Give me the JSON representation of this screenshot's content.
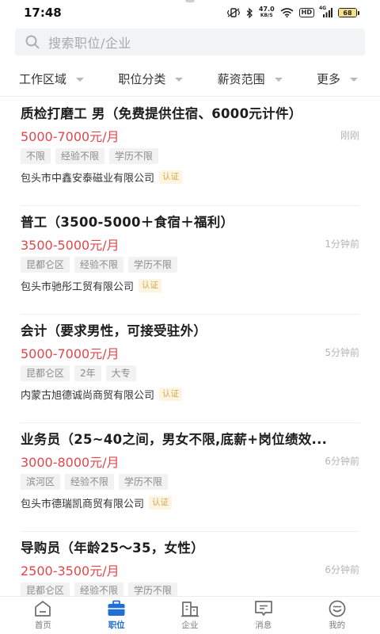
{
  "status_bar": {
    "time": "17:48",
    "net_speed_value": "47.0",
    "net_speed_unit": "KB/S",
    "hd_label": "HD",
    "signal_label": "4G",
    "battery": "68"
  },
  "search": {
    "placeholder": "搜索职位/企业"
  },
  "filters": [
    {
      "label": "工作区域"
    },
    {
      "label": "职位分类"
    },
    {
      "label": "薪资范围"
    },
    {
      "label": "更多"
    }
  ],
  "jobs": [
    {
      "title": "质检打磨工 男（免费提供住宿、6000元计件）",
      "salary": "5000-7000元/月",
      "time": "刚刚",
      "tags": [
        "不限",
        "经验不限",
        "学历不限"
      ],
      "company": "包头市中鑫安泰磁业有限公司",
      "badge": "认证"
    },
    {
      "title": "普工（3500-5000＋食宿＋福利）",
      "salary": "3500-5000元/月",
      "time": "1分钟前",
      "tags": [
        "昆都仑区",
        "经验不限",
        "学历不限"
      ],
      "company": "包头市驰彤工贸有限公司",
      "badge": "认证"
    },
    {
      "title": "会计（要求男性，可接受驻外）",
      "salary": "5000-7000元/月",
      "time": "5分钟前",
      "tags": [
        "昆都仑区",
        "2年",
        "大专"
      ],
      "company": "内蒙古旭德诚尚商贸有限公司",
      "badge": "认证"
    },
    {
      "title": "业务员（25~40之间，男女不限,底薪+岗位绩效...",
      "salary": "3000-8000元/月",
      "time": "6分钟前",
      "tags": [
        "滨河区",
        "经验不限",
        "学历不限"
      ],
      "company": "包头市德瑞凯商贸有限公司",
      "badge": "认证"
    },
    {
      "title": "导购员（年龄25～35，女性）",
      "salary": "2500-3500元/月",
      "time": "6分钟前",
      "tags": [
        "昆都仑区",
        "经验不限",
        "学历不限"
      ],
      "company": "",
      "badge": ""
    }
  ],
  "nav": [
    {
      "label": "首页",
      "icon": "home-icon"
    },
    {
      "label": "职位",
      "icon": "briefcase-icon",
      "active": true
    },
    {
      "label": "企业",
      "icon": "building-icon"
    },
    {
      "label": "消息",
      "icon": "message-icon"
    },
    {
      "label": "我的",
      "icon": "profile-icon"
    }
  ],
  "colors": {
    "salary": "#e0474c",
    "accent": "#1f6fd6",
    "badge_bg": "#fdf4e2",
    "badge_text": "#d7a84a"
  }
}
